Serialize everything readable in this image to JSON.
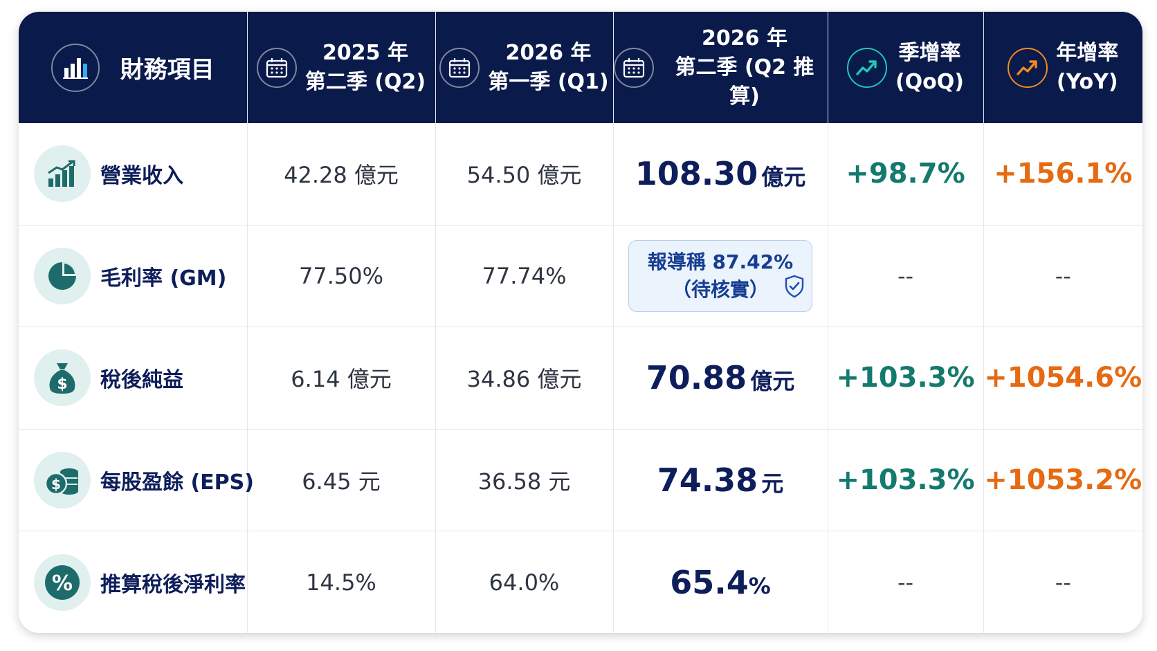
{
  "header": {
    "item_label": "財務項目",
    "col1": {
      "line1": "2025 年",
      "line2": "第二季 (Q2)"
    },
    "col2": {
      "line1": "2026 年",
      "line2": "第一季 (Q1)"
    },
    "col3": {
      "line1": "2026 年",
      "line2": "第二季 (Q2 推算)"
    },
    "col4": {
      "line1": "季增率",
      "line2": "(QoQ)"
    },
    "col5": {
      "line1": "年增率",
      "line2": "(YoY)"
    }
  },
  "rows": {
    "revenue": {
      "label": "營業收入",
      "q2_2025": "42.28 億元",
      "q1_2026": "54.50 億元",
      "q2_2026_value": "108.30",
      "q2_2026_unit": "億元",
      "qoq_value": "+98.7",
      "qoq_pct": "%",
      "yoy_value": "+156.1",
      "yoy_pct": "%"
    },
    "gross_margin": {
      "label": "毛利率 (GM)",
      "q2_2025": "77.50%",
      "q1_2026": "77.74%",
      "note_line1": "報導稱 87.42%",
      "note_line2": "（待核實）",
      "qoq": "--",
      "yoy": "--"
    },
    "net_income": {
      "label": "稅後純益",
      "q2_2025": "6.14 億元",
      "q1_2026": "34.86 億元",
      "q2_2026_value": "70.88",
      "q2_2026_unit": "億元",
      "qoq_value": "+103.3",
      "qoq_pct": "%",
      "yoy_value": "+1054.6",
      "yoy_pct": "%"
    },
    "eps": {
      "label": "每股盈餘 (EPS)",
      "q2_2025": "6.45 元",
      "q1_2026": "36.58 元",
      "q2_2026_value": "74.38",
      "q2_2026_unit": "元",
      "qoq_value": "+103.3",
      "qoq_pct": "%",
      "yoy_value": "+1053.2",
      "yoy_pct": "%"
    },
    "net_margin": {
      "label": "推算稅後淨利率",
      "q2_2025": "14.5%",
      "q1_2026": "64.0%",
      "q2_2026_value": "65.4",
      "q2_2026_pct": "%",
      "qoq": "--",
      "yoy": "--"
    }
  },
  "colors": {
    "header_bg": "#0a1a4b",
    "navy_text": "#0e1e5b",
    "teal": "#157a6e",
    "orange": "#e56a12",
    "icon_bg": "#dff0ee"
  },
  "icons": {
    "header_item": "bar-chart-icon",
    "header_date": "calendar-icon",
    "header_qoq": "trend-up-icon",
    "header_yoy": "trend-up-icon",
    "revenue": "growth-chart-icon",
    "gross_margin": "pie-chart-icon",
    "net_income": "money-bag-icon",
    "eps": "coins-icon",
    "net_margin": "percent-icon",
    "note": "shield-check-icon"
  }
}
